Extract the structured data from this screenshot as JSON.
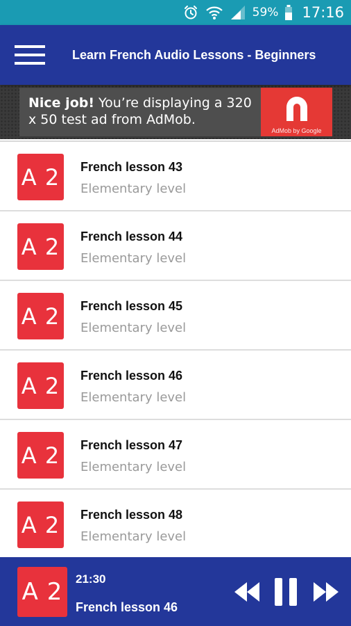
{
  "status_bar": {
    "icons": [
      "alarm-icon",
      "wifi-icon",
      "signal-icon",
      "battery-icon"
    ],
    "battery": "59%",
    "time": "17:16"
  },
  "app_bar": {
    "menu_icon": "hamburger-menu-icon",
    "title": "Learn French Audio Lessons - Beginners"
  },
  "ad": {
    "bold": "Nice job!",
    "text": " You’re displaying a 320 x 50 test ad from AdMob.",
    "logo_caption": "AdMob by Google"
  },
  "lessons": [
    {
      "badge": "A 2",
      "title": "French lesson 43",
      "subtitle": "Elementary level"
    },
    {
      "badge": "A 2",
      "title": "French lesson 44",
      "subtitle": "Elementary level"
    },
    {
      "badge": "A 2",
      "title": "French lesson 45",
      "subtitle": "Elementary level"
    },
    {
      "badge": "A 2",
      "title": "French lesson 46",
      "subtitle": "Elementary level"
    },
    {
      "badge": "A 2",
      "title": "French lesson 47",
      "subtitle": "Elementary level"
    },
    {
      "badge": "A 2",
      "title": "French lesson 48",
      "subtitle": "Elementary level"
    }
  ],
  "player": {
    "badge": "A 2",
    "time": "21:30",
    "title": "French lesson 46",
    "controls": [
      "rewind-icon",
      "pause-icon",
      "fast-forward-icon"
    ]
  },
  "colors": {
    "status_bar": "#1a9bb3",
    "app_bar": "#23379a",
    "badge": "#e8323c",
    "ad_logo": "#e53935"
  }
}
